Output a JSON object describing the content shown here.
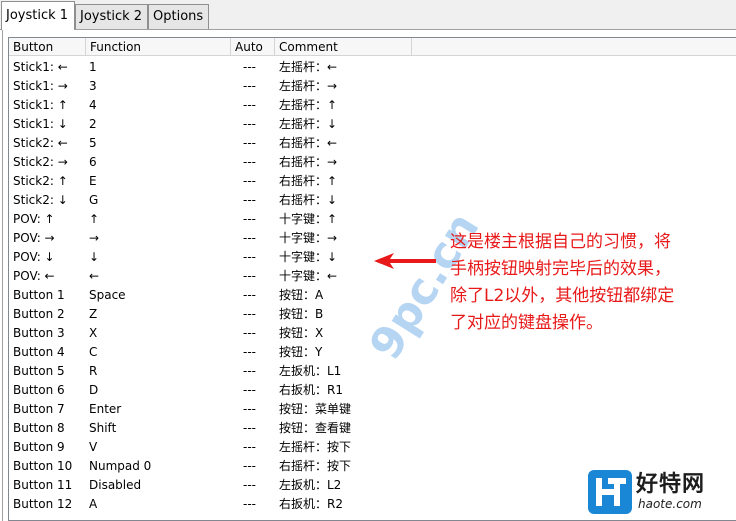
{
  "tabs": [
    {
      "label": "Joystick 1",
      "active": true
    },
    {
      "label": "Joystick 2",
      "active": false
    },
    {
      "label": "Options",
      "active": false
    }
  ],
  "columns": [
    "Button",
    "Function",
    "Auto",
    "Comment"
  ],
  "rows": [
    [
      "Stick1: ←",
      "1",
      "---",
      "左摇杆：←"
    ],
    [
      "Stick1: →",
      "3",
      "---",
      "左摇杆：→"
    ],
    [
      "Stick1: ↑",
      "4",
      "---",
      "左摇杆：↑"
    ],
    [
      "Stick1: ↓",
      "2",
      "---",
      "左摇杆：↓"
    ],
    [
      "Stick2: ←",
      "5",
      "---",
      "右摇杆：←"
    ],
    [
      "Stick2: →",
      "6",
      "---",
      "右摇杆：→"
    ],
    [
      "Stick2: ↑",
      "E",
      "---",
      "右摇杆：↑"
    ],
    [
      "Stick2: ↓",
      "G",
      "---",
      "右摇杆：↓"
    ],
    [
      "POV: ↑",
      "↑",
      "---",
      "十字键：↑"
    ],
    [
      "POV: →",
      "→",
      "---",
      "十字键：→"
    ],
    [
      "POV: ↓",
      "↓",
      "---",
      "十字键：↓"
    ],
    [
      "POV: ←",
      "←",
      "---",
      "十字键：←"
    ],
    [
      "Button 1",
      "Space",
      "---",
      "按钮：A"
    ],
    [
      "Button 2",
      "Z",
      "---",
      "按钮：B"
    ],
    [
      "Button 3",
      "X",
      "---",
      "按钮：X"
    ],
    [
      "Button 4",
      "C",
      "---",
      "按钮：Y"
    ],
    [
      "Button 5",
      "R",
      "---",
      "左扳机：L1"
    ],
    [
      "Button 6",
      "D",
      "---",
      "右扳机：R1"
    ],
    [
      "Button 7",
      "Enter",
      "---",
      "按钮：菜单键"
    ],
    [
      "Button 8",
      "Shift",
      "---",
      "按钮：查看键"
    ],
    [
      "Button 9",
      "V",
      "---",
      "左摇杆：按下"
    ],
    [
      "Button 10",
      "Numpad 0",
      "---",
      "右摇杆：按下"
    ],
    [
      "Button 11",
      "Disabled",
      "---",
      "左扳机：L2"
    ],
    [
      "Button 12",
      "A",
      "---",
      "右扳机：R2"
    ]
  ],
  "annotation": {
    "lines": [
      "这是楼主根据自己的习惯，将",
      "手柄按钮映射完毕后的效果，",
      "除了L2以外，其他按钮都绑定",
      "了对应的键盘操作。"
    ],
    "color": "#e81919"
  },
  "watermark": {
    "text": "9pc.cn"
  },
  "logo": {
    "name": "好特网",
    "url_text": "haote.com",
    "icon_color": "#1a86d6"
  }
}
